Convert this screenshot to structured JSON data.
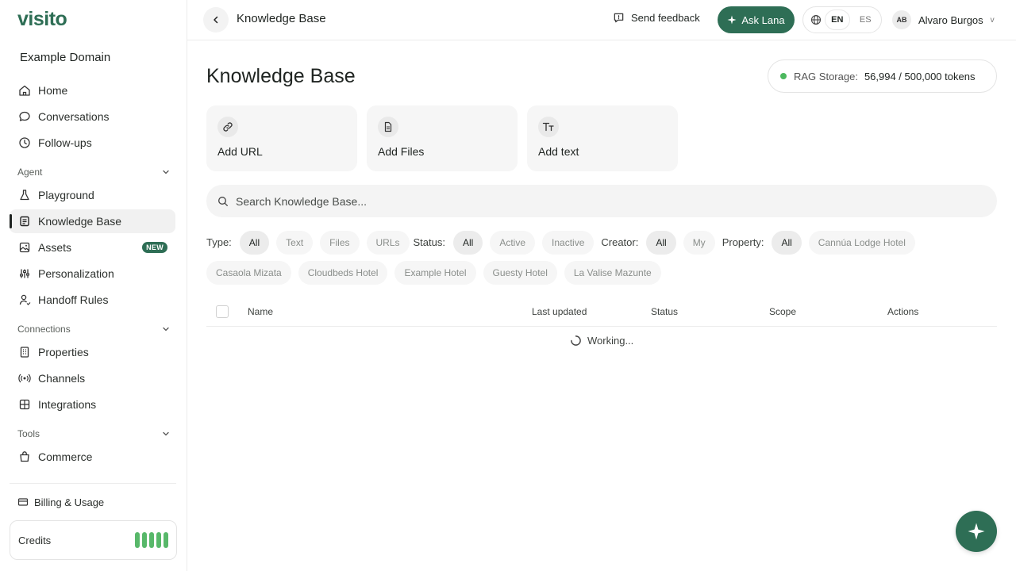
{
  "app": {
    "logo": "visito",
    "domain": "Example Domain"
  },
  "sidebar": {
    "items_top": [
      {
        "label": "Home",
        "icon": "home-icon"
      },
      {
        "label": "Conversations",
        "icon": "chat-icon"
      },
      {
        "label": "Follow-ups",
        "icon": "clock-icon"
      }
    ],
    "agent_section": "Agent",
    "agent_items": [
      {
        "label": "Playground",
        "icon": "flask-icon"
      },
      {
        "label": "Knowledge Base",
        "icon": "book-icon",
        "active": true
      },
      {
        "label": "Assets",
        "icon": "image-icon",
        "badge": "NEW"
      },
      {
        "label": "Personalization",
        "icon": "sliders-icon"
      },
      {
        "label": "Handoff Rules",
        "icon": "user-icon"
      }
    ],
    "connections_section": "Connections",
    "connection_items": [
      {
        "label": "Properties",
        "icon": "building-icon"
      },
      {
        "label": "Channels",
        "icon": "broadcast-icon"
      },
      {
        "label": "Integrations",
        "icon": "puzzle-icon"
      }
    ],
    "tools_section": "Tools",
    "tools_items": [
      {
        "label": "Commerce",
        "icon": "bag-icon"
      }
    ],
    "billing_label": "Billing & Usage",
    "credits_label": "Credits",
    "credits_level": 1.0
  },
  "topbar": {
    "title": "Knowledge Base",
    "feedback_label": "Send feedback",
    "ask_label": "Ask Lana",
    "lang_options": [
      "EN",
      "ES"
    ],
    "lang_selected": "EN",
    "user_initials": "AB",
    "user_name": "Alvaro Burgos",
    "user_chevron": "v"
  },
  "main": {
    "title": "Knowledge Base",
    "rag": {
      "label": "RAG Storage:",
      "value": "56,994 / 500,000 tokens",
      "status_color": "#4cb85e"
    },
    "add_cards": [
      {
        "label": "Add URL",
        "icon": "link-icon"
      },
      {
        "label": "Add Files",
        "icon": "file-icon"
      },
      {
        "label": "Add text",
        "icon": "text-icon"
      }
    ],
    "search_placeholder": "Search Knowledge Base...",
    "filters": {
      "type_label": "Type:",
      "type_options": [
        "All",
        "Text",
        "Files",
        "URLs"
      ],
      "status_label": "Status:",
      "status_options": [
        "All",
        "Active",
        "Inactive"
      ],
      "creator_label": "Creator:",
      "creator_options": [
        "All",
        "My"
      ],
      "property_label": "Property:",
      "property_options": [
        "All",
        "Cannúa Lodge Hotel",
        "Casaola Mizata",
        "Cloudbeds Hotel",
        "Example Hotel",
        "Guesty Hotel",
        "La Valise Mazunte"
      ]
    },
    "table": {
      "columns": [
        "Name",
        "Last updated",
        "Status",
        "Scope",
        "Actions"
      ],
      "loading_text": "Working..."
    }
  },
  "colors": {
    "brand": "#2e6e55",
    "accent_green": "#58b86a"
  }
}
